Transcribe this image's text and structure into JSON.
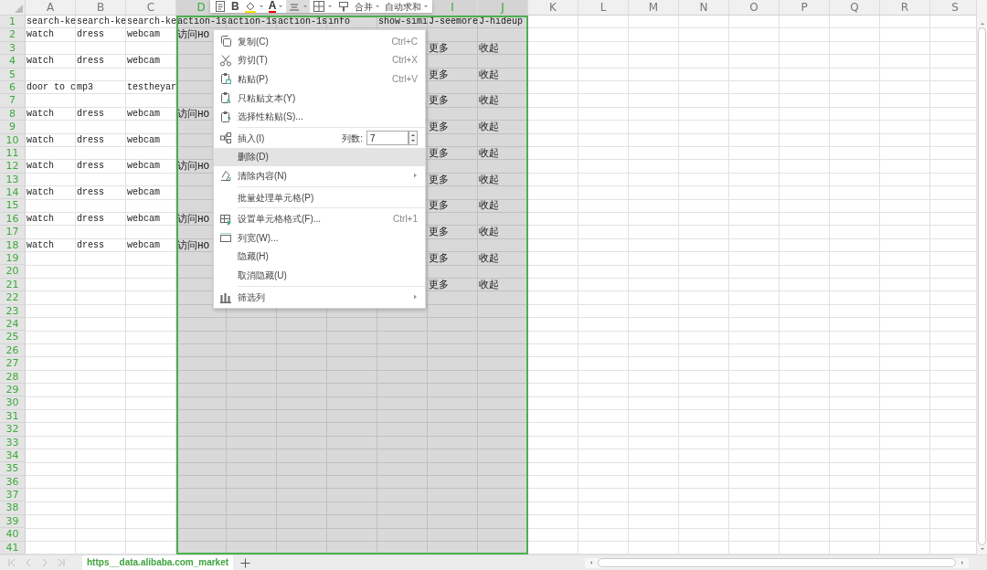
{
  "toolbar": [
    {
      "kind": "icon",
      "dropdown": false,
      "selected": false
    },
    {
      "kind": "text",
      "label": "B",
      "dropdown": false,
      "selected": false
    },
    {
      "kind": "icon",
      "dropdown": true,
      "selected": false
    },
    {
      "kind": "text",
      "label": "A",
      "dropdown": true,
      "selected": false
    },
    {
      "kind": "icon",
      "dropdown": true,
      "selected": true
    },
    {
      "kind": "icon",
      "dropdown": true,
      "selected": false
    },
    {
      "kind": "icon",
      "dropdown": false,
      "selected": false
    },
    {
      "kind": "text",
      "label": "合并",
      "dropdown": true,
      "selected": false
    },
    {
      "kind": "text",
      "label": "自动求和",
      "dropdown": true,
      "selected": false
    }
  ],
  "columns": [
    {
      "label": "A",
      "selected": false
    },
    {
      "label": "B",
      "selected": false
    },
    {
      "label": "C",
      "selected": false
    },
    {
      "label": "D",
      "selected": true
    },
    {
      "selected": true
    },
    {
      "selected": true
    },
    {
      "selected": true
    },
    {
      "selected": true
    },
    {
      "label": "I",
      "selected": true
    },
    {
      "label": "J",
      "selected": true
    },
    {
      "label": "K",
      "selected": false
    },
    {
      "label": "L",
      "selected": false
    },
    {
      "label": "M",
      "selected": false
    },
    {
      "label": "N",
      "selected": false
    },
    {
      "label": "O",
      "selected": false
    },
    {
      "label": "P",
      "selected": false
    },
    {
      "label": "Q",
      "selected": false
    },
    {
      "label": "R",
      "selected": false
    },
    {
      "label": "S",
      "selected": false
    }
  ],
  "rows": [
    {
      "number": "1",
      "selected": true,
      "cells": [
        "search-ke",
        "search-ke",
        "search-ke",
        "action-1s",
        "action-1s",
        "action-1s",
        "info",
        "show-simi",
        "J-seemore",
        "J-hideup"
      ]
    },
    {
      "number": "2",
      "selected": true,
      "cells": [
        "watch",
        "dress",
        "webcam",
        "访问HO"
      ]
    },
    {
      "number": "3",
      "selected": true,
      "cells": [
        null,
        null,
        null,
        null,
        null,
        null,
        null,
        null,
        "更多",
        "收起"
      ]
    },
    {
      "number": "4",
      "selected": true,
      "cells": [
        "watch",
        "dress",
        "webcam"
      ]
    },
    {
      "number": "5",
      "selected": true,
      "cells": [
        null,
        null,
        null,
        null,
        null,
        null,
        null,
        null,
        "更多",
        "收起"
      ]
    },
    {
      "number": "6",
      "selected": true,
      "cells": [
        "door to c",
        "mp3",
        "testheyar"
      ]
    },
    {
      "number": "7",
      "selected": true,
      "cells": [
        null,
        null,
        null,
        null,
        null,
        null,
        null,
        null,
        "更多",
        "收起"
      ]
    },
    {
      "number": "8",
      "selected": true,
      "cells": [
        "watch",
        "dress",
        "webcam",
        "访问HO"
      ]
    },
    {
      "number": "9",
      "selected": true,
      "cells": [
        null,
        null,
        null,
        null,
        null,
        null,
        null,
        null,
        "更多",
        "收起"
      ]
    },
    {
      "number": "10",
      "selected": true,
      "cells": [
        "watch",
        "dress",
        "webcam"
      ]
    },
    {
      "number": "11",
      "selected": true,
      "cells": [
        null,
        null,
        null,
        null,
        null,
        null,
        null,
        null,
        "更多",
        "收起"
      ]
    },
    {
      "number": "12",
      "selected": true,
      "cells": [
        "watch",
        "dress",
        "webcam",
        "访问HO"
      ]
    },
    {
      "number": "13",
      "selected": true,
      "cells": [
        null,
        null,
        null,
        null,
        null,
        null,
        null,
        null,
        "更多",
        "收起"
      ]
    },
    {
      "number": "14",
      "selected": true,
      "cells": [
        "watch",
        "dress",
        "webcam"
      ]
    },
    {
      "number": "15",
      "selected": true,
      "cells": [
        null,
        null,
        null,
        null,
        null,
        null,
        null,
        null,
        "更多",
        "收起"
      ]
    },
    {
      "number": "16",
      "selected": true,
      "cells": [
        "watch",
        "dress",
        "webcam",
        "访问HO"
      ]
    },
    {
      "number": "17",
      "selected": true,
      "cells": [
        null,
        null,
        null,
        null,
        null,
        null,
        null,
        null,
        "更多",
        "收起"
      ]
    },
    {
      "number": "18",
      "selected": true,
      "cells": [
        "watch",
        "dress",
        "webcam",
        "访问HO"
      ]
    },
    {
      "number": "19",
      "selected": true,
      "cells": [
        null,
        null,
        null,
        null,
        null,
        null,
        null,
        null,
        "更多",
        "收起"
      ]
    },
    {
      "number": "20",
      "selected": true
    },
    {
      "number": "21",
      "selected": true,
      "cells": [
        null,
        null,
        null,
        null,
        null,
        null,
        null,
        null,
        "更多",
        "收起"
      ]
    },
    {
      "number": "22",
      "selected": true
    },
    {
      "number": "23",
      "selected": true
    },
    {
      "number": "24",
      "selected": true
    },
    {
      "number": "25",
      "selected": true
    },
    {
      "number": "26",
      "selected": true
    },
    {
      "number": "27",
      "selected": true
    },
    {
      "number": "28",
      "selected": true
    },
    {
      "number": "29",
      "selected": true
    },
    {
      "number": "30",
      "selected": true
    },
    {
      "number": "31",
      "selected": true
    },
    {
      "number": "32",
      "selected": true
    },
    {
      "number": "33",
      "selected": true
    },
    {
      "number": "34",
      "selected": true
    },
    {
      "number": "35",
      "selected": true
    },
    {
      "number": "36",
      "selected": true
    },
    {
      "number": "37",
      "selected": true
    },
    {
      "number": "38",
      "selected": true
    },
    {
      "number": "39",
      "selected": true
    },
    {
      "number": "40",
      "selected": true
    },
    {
      "number": "41",
      "selected": true
    }
  ],
  "context_menu": [
    {
      "kind": "item",
      "label": "复制(C)",
      "shortcut": "Ctrl+C",
      "highlighted": false,
      "submenu": false
    },
    {
      "kind": "item",
      "label": "剪切(T)",
      "shortcut": "Ctrl+X",
      "highlighted": false,
      "submenu": false
    },
    {
      "kind": "item",
      "label": "粘贴(P)",
      "shortcut": "Ctrl+V",
      "highlighted": false,
      "submenu": false
    },
    {
      "kind": "item",
      "label": "只粘贴文本(Y)",
      "highlighted": false,
      "submenu": false
    },
    {
      "kind": "item",
      "label": "选择性粘贴(S)...",
      "highlighted": false,
      "submenu": false
    },
    {
      "kind": "separator"
    },
    {
      "kind": "spinner",
      "label": "插入(I)",
      "field_label": "列数:",
      "value": "7",
      "highlighted": false
    },
    {
      "kind": "item",
      "label": "删除(D)",
      "highlighted": true,
      "submenu": false
    },
    {
      "kind": "item",
      "label": "清除内容(N)",
      "highlighted": false,
      "submenu": true
    },
    {
      "kind": "separator"
    },
    {
      "kind": "item",
      "label": "批量处理单元格(P)",
      "highlighted": false,
      "submenu": false
    },
    {
      "kind": "separator"
    },
    {
      "kind": "item",
      "label": "设置单元格格式(F)...",
      "shortcut": "Ctrl+1",
      "highlighted": false,
      "submenu": false
    },
    {
      "kind": "item",
      "label": "列宽(W)...",
      "highlighted": false,
      "submenu": false
    },
    {
      "kind": "item",
      "label": "隐藏(H)",
      "highlighted": false,
      "submenu": false
    },
    {
      "kind": "item",
      "label": "取消隐藏(U)",
      "highlighted": false,
      "submenu": false
    },
    {
      "kind": "separator"
    },
    {
      "kind": "item",
      "label": "筛选列",
      "highlighted": false,
      "submenu": true
    }
  ],
  "sheet_tabs": [
    {
      "label": "https__data.alibaba.com_market",
      "selected": true
    }
  ]
}
